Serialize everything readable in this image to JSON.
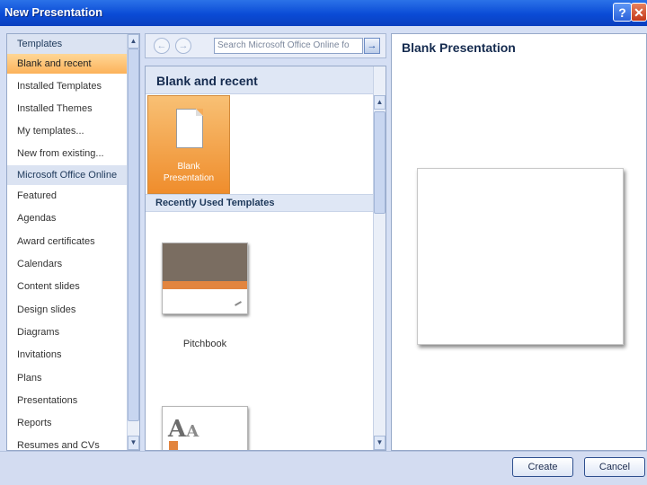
{
  "window": {
    "title": "New Presentation",
    "help_label": "?",
    "close_label": "✕"
  },
  "sidebar": {
    "items": [
      {
        "label": "Templates",
        "kind": "header"
      },
      {
        "label": "Blank and recent",
        "kind": "selected"
      },
      {
        "label": "Installed Templates",
        "kind": "item"
      },
      {
        "label": "Installed Themes",
        "kind": "item"
      },
      {
        "label": "My templates...",
        "kind": "item"
      },
      {
        "label": "New from existing...",
        "kind": "item"
      },
      {
        "label": "Microsoft Office Online",
        "kind": "header"
      },
      {
        "label": "Featured",
        "kind": "item"
      },
      {
        "label": "Agendas",
        "kind": "item"
      },
      {
        "label": "Award certificates",
        "kind": "item"
      },
      {
        "label": "Calendars",
        "kind": "item"
      },
      {
        "label": "Content slides",
        "kind": "item"
      },
      {
        "label": "Design slides",
        "kind": "item"
      },
      {
        "label": "Diagrams",
        "kind": "item"
      },
      {
        "label": "Invitations",
        "kind": "item"
      },
      {
        "label": "Plans",
        "kind": "item"
      },
      {
        "label": "Presentations",
        "kind": "item"
      },
      {
        "label": "Reports",
        "kind": "item"
      },
      {
        "label": "Resumes and CVs",
        "kind": "item"
      }
    ]
  },
  "toolbar": {
    "search_placeholder": "Search Microsoft Office Online fo",
    "back_icon": "←",
    "forward_icon": "→",
    "go_icon": "→"
  },
  "middle": {
    "title": "Blank and recent",
    "blank_tile_label_line1": "Blank",
    "blank_tile_label_line2": "Presentation",
    "recent_section": "Recently Used Templates",
    "recent_templates": [
      {
        "label": "Pitchbook"
      }
    ]
  },
  "preview": {
    "title": "Blank Presentation"
  },
  "buttons": {
    "create": "Create",
    "cancel": "Cancel"
  },
  "scroll_icons": {
    "up": "▲",
    "down": "▼"
  }
}
